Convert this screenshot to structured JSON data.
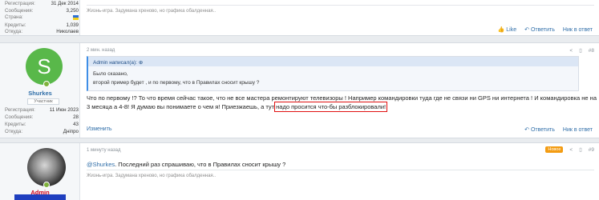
{
  "post1": {
    "stats": [
      {
        "key": "Регистрация:",
        "value": "31 Дек 2014"
      },
      {
        "key": "Сообщения:",
        "value": "3,250"
      },
      {
        "key": "Страна:",
        "value": ""
      },
      {
        "key": "Кредиты:",
        "value": "1,039"
      },
      {
        "key": "Откуда:",
        "value": "Николаев"
      }
    ],
    "signature": "Жизнь-игра. Задумана хреново, но графика обалденная..",
    "actions": {
      "like": "Like",
      "reply": "Ответить",
      "report": "Ник в ответ"
    }
  },
  "post2": {
    "avatar_letter": "S",
    "username": "Shurkes",
    "role": "Участник",
    "stats": [
      {
        "key": "Регистрация:",
        "value": "11 Июн 2023"
      },
      {
        "key": "Сообщения:",
        "value": "28"
      },
      {
        "key": "Кредиты:",
        "value": "43"
      },
      {
        "key": "Откуда:",
        "value": "Днiпро"
      }
    ],
    "time": "2 мин. назад",
    "number": "#8",
    "quote": {
      "author": "Admin написал(а):",
      "line1": "Было сказано,",
      "line2": "второй пример будет , и по первому, что в Правилах сносит крышу ?"
    },
    "text_before": "Что по первому !? То что время сейчас такое, что не все мастера ремонтируют телевизоры ! Например командировки туда где не связи ни GPS ни интернета ! И командировка не на 3 месяца а 4-8! Я думаю вы понимаете о чем я! Приезжаешь, а тут ",
    "text_highlight": "надо просится что-бы разблокировали!",
    "edit": "Изменить",
    "actions": {
      "reply": "Ответить",
      "report": "Ник в ответ"
    }
  },
  "post3": {
    "username": "Admin",
    "time": "1 минуту назад",
    "badge": "Новое",
    "number": "#9",
    "mention": "@Shurkes",
    "text": ". Последний раз спрашиваю, что в Правилах сносит крышу ?",
    "signature": "Жизнь-игра. Задумана хреново, но графика обалденная.."
  }
}
